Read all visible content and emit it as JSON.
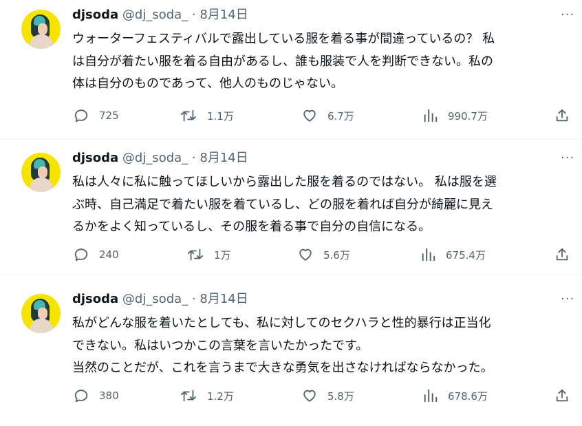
{
  "tweets": [
    {
      "name": "djsoda",
      "handle": "@dj_soda_",
      "sep": "·",
      "date": "8月14日",
      "lines": [
        "ウォーターフェスティバルで露出している服を着る事が間違っているの？ 私",
        "は自分が着たい服を着る自由があるし、誰も服装で人を判断できない。私の",
        "体は自分のものであって、他人のものじゃない。"
      ],
      "replies": "725",
      "retweets": "1.1万",
      "likes": "6.7万",
      "views": "990.7万"
    },
    {
      "name": "djsoda",
      "handle": "@dj_soda_",
      "sep": "·",
      "date": "8月14日",
      "lines": [
        "私は人々に私に触ってほしいから露出した服を着るのではない。 私は服を選",
        "ぶ時、自己満足で着たい服を着ているし、どの服を着れば自分が綺麗に見え",
        "るかをよく知っているし、その服を着る事で自分の自信になる。"
      ],
      "replies": "240",
      "retweets": "1万",
      "likes": "5.6万",
      "views": "675.4万"
    },
    {
      "name": "djsoda",
      "handle": "@dj_soda_",
      "sep": "·",
      "date": "8月14日",
      "lines": [
        "私がどんな服を着いたとしても、私に対してのセクハラと性的暴行は正当化",
        "できない。私はいつかこの言葉を言いたかったです。",
        "当然のことだが、これを言うまで大きな勇気を出さなければならなかった。"
      ],
      "replies": "380",
      "retweets": "1.2万",
      "likes": "5.8万",
      "views": "678.6万"
    }
  ],
  "more_label": "···",
  "icons": {
    "reply": "reply-icon",
    "retweet": "retweet-icon",
    "like": "heart-icon",
    "views": "views-icon",
    "share": "share-icon"
  },
  "colors": {
    "text": "#0f1419",
    "muted": "#536471",
    "divider": "#eff3f4",
    "avatar_bg": "#f5e400"
  }
}
